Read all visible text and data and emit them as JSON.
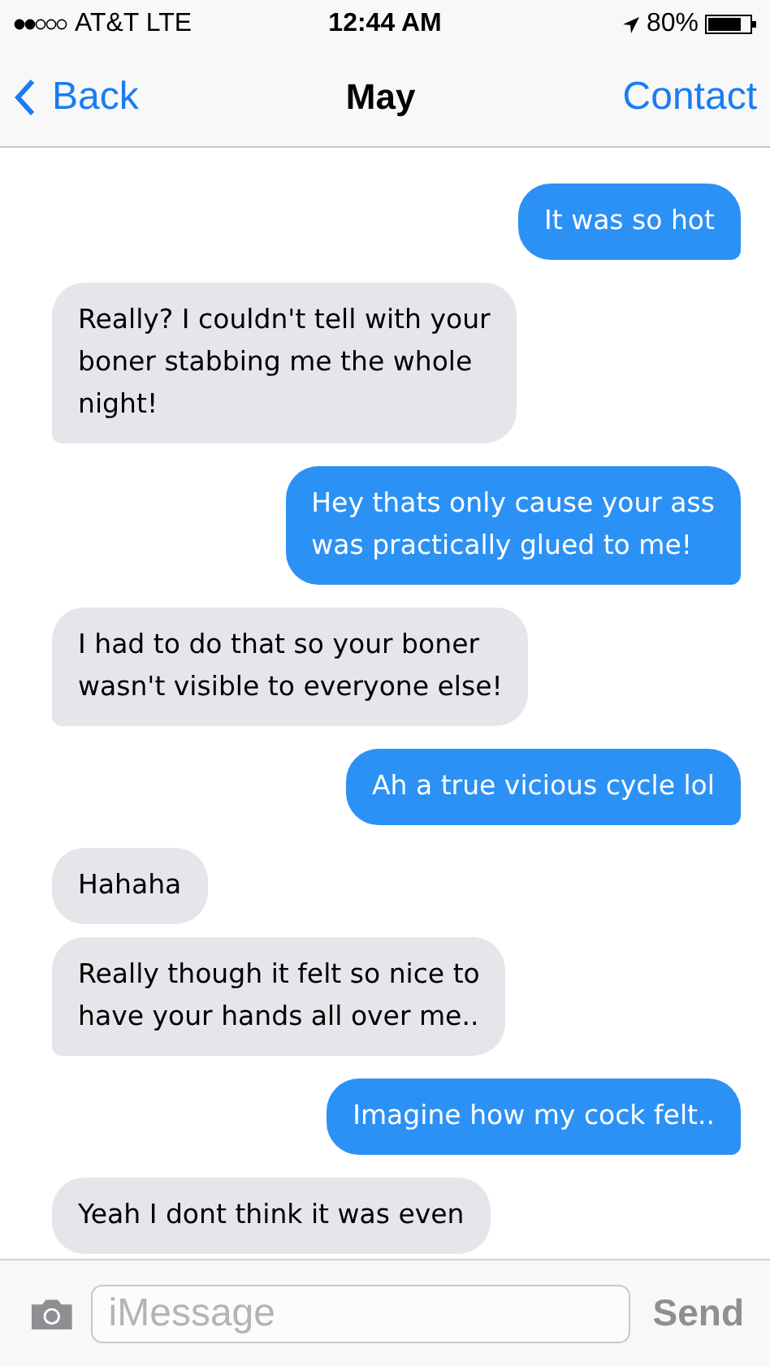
{
  "status_bar": {
    "carrier": "AT&T LTE",
    "time": "12:44 AM",
    "battery": "80%"
  },
  "nav": {
    "back": "Back",
    "title": "May",
    "action": "Contact"
  },
  "messages": [
    {
      "kind": "sent",
      "text": "It was so hot"
    },
    {
      "kind": "received",
      "text": "Really? I couldn't tell with your\nboner stabbing me the whole\nnight!"
    },
    {
      "kind": "sent",
      "text": "Hey thats only cause your ass\nwas practically glued to me!"
    },
    {
      "kind": "received",
      "text": "I had to do that so your boner\nwasn't visible to everyone else!"
    },
    {
      "kind": "sent",
      "text": "Ah a true vicious cycle lol"
    },
    {
      "kind": "received",
      "text": "Hahaha"
    },
    {
      "kind": "received",
      "text": "Really though it felt so nice to\nhave your hands all over me.."
    },
    {
      "kind": "sent",
      "text": "Imagine how my cock felt.."
    },
    {
      "kind": "received",
      "text": "Yeah I dont think it was even"
    }
  ],
  "composer": {
    "placeholder": "iMessage",
    "send": "Send"
  }
}
